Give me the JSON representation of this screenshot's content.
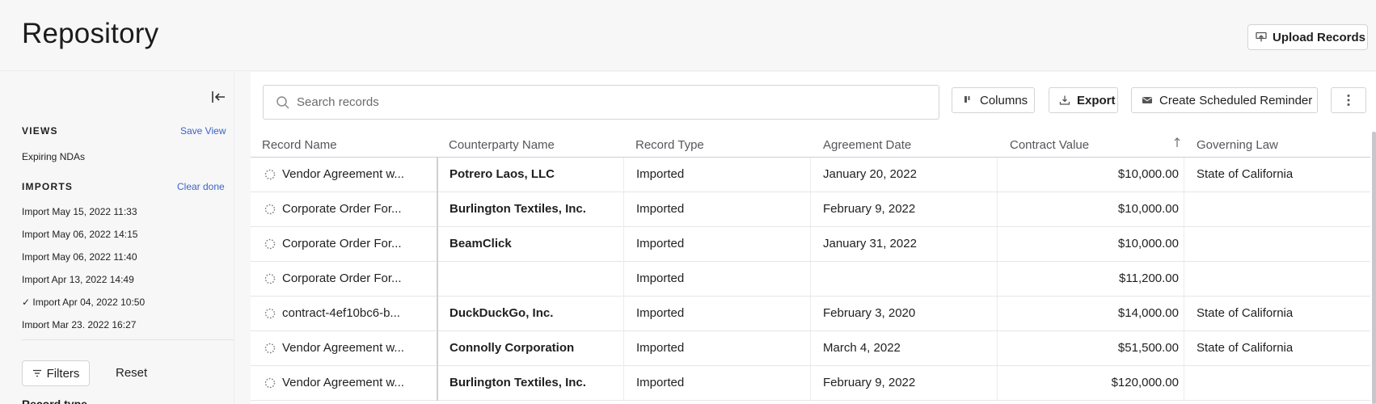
{
  "header": {
    "title": "Repository",
    "upload_label": "Upload Records"
  },
  "sidebar": {
    "views_heading": "VIEWS",
    "save_view_label": "Save View",
    "views": [
      "Expiring NDAs"
    ],
    "imports_heading": "IMPORTS",
    "clear_done_label": "Clear done",
    "imports": [
      "Import May 15, 2022 11:33",
      "Import May 06, 2022 14:15",
      "Import May 06, 2022 11:40",
      "Import Apr 13, 2022 14:49",
      "✓ Import Apr 04, 2022 10:50",
      "Import Mar 23, 2022 16:27"
    ],
    "filters_label": "Filters",
    "reset_label": "Reset",
    "record_type_label": "Record type"
  },
  "toolbar": {
    "search_placeholder": "Search records",
    "columns_label": "Columns",
    "export_label": "Export",
    "reminder_label": "Create Scheduled Reminder"
  },
  "table": {
    "columns": [
      "Record Name",
      "Counterparty Name",
      "Record Type",
      "Agreement Date",
      "Contract Value",
      "Governing Law"
    ],
    "rows": [
      {
        "name": "Vendor Agreement w...",
        "counterparty": "Potrero Laos, LLC",
        "type": "Imported",
        "date": "January 20, 2022",
        "value": "$10,000.00",
        "law": "State of California"
      },
      {
        "name": "Corporate Order For...",
        "counterparty": "Burlington Textiles, Inc.",
        "type": "Imported",
        "date": "February 9, 2022",
        "value": "$10,000.00",
        "law": ""
      },
      {
        "name": "Corporate Order For...",
        "counterparty": "BeamClick",
        "type": "Imported",
        "date": "January 31, 2022",
        "value": "$10,000.00",
        "law": ""
      },
      {
        "name": "Corporate Order For...",
        "counterparty": "",
        "type": "Imported",
        "date": "",
        "value": "$11,200.00",
        "law": ""
      },
      {
        "name": "contract-4ef10bc6-b...",
        "counterparty": "DuckDuckGo, Inc.",
        "type": "Imported",
        "date": "February 3, 2020",
        "value": "$14,000.00",
        "law": "State of California"
      },
      {
        "name": "Vendor Agreement w...",
        "counterparty": "Connolly Corporation",
        "type": "Imported",
        "date": "March 4, 2022",
        "value": "$51,500.00",
        "law": "State of California"
      },
      {
        "name": "Vendor Agreement w...",
        "counterparty": "Burlington Textiles, Inc.",
        "type": "Imported",
        "date": "February 9, 2022",
        "value": "$120,000.00",
        "law": ""
      }
    ]
  }
}
